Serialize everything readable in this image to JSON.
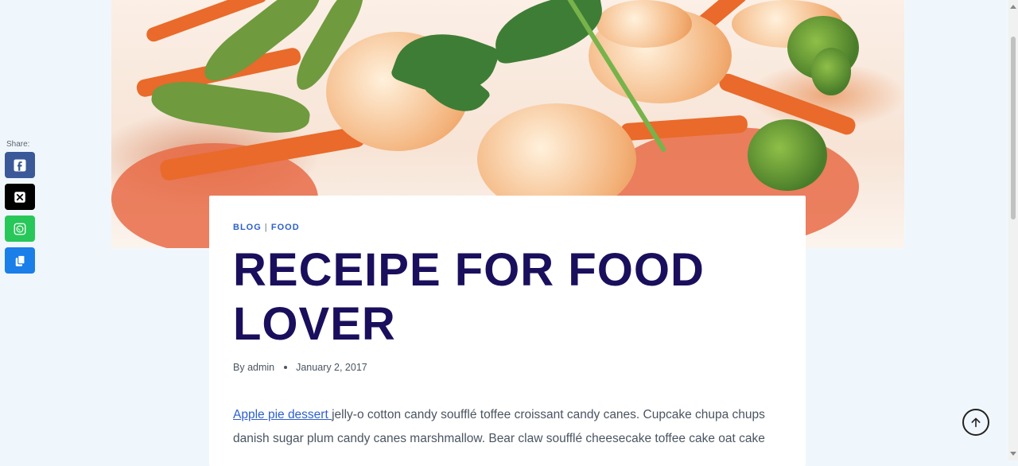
{
  "share": {
    "label": "Share:",
    "buttons": [
      {
        "name": "facebook",
        "icon": "facebook-icon",
        "color": "#3b5998"
      },
      {
        "name": "x",
        "icon": "x-icon",
        "color": "#000000"
      },
      {
        "name": "whatsapp",
        "icon": "whatsapp-icon",
        "color": "#28c75a"
      },
      {
        "name": "copy",
        "icon": "copy-icon",
        "color": "#1a7fe8"
      }
    ]
  },
  "article": {
    "categories": [
      "BLOG",
      "FOOD"
    ],
    "category_separator": "|",
    "title": "RECEIPE FOR FOOD LOVER",
    "author_prefix": "By",
    "author": "admin",
    "date": "January 2, 2017",
    "body_link": "Apple pie dessert ",
    "body_text": "jelly-o cotton candy soufflé toffee croissant candy canes. Cupcake chupa chups danish sugar plum candy canes marshmallow. Bear claw soufflé cheesecake toffee cake oat cake"
  },
  "colors": {
    "title": "#1a0f5c",
    "link": "#2d5fcf",
    "page_background": "#f0f7fc"
  },
  "icons": {
    "scroll_top": "arrow-up-icon"
  }
}
